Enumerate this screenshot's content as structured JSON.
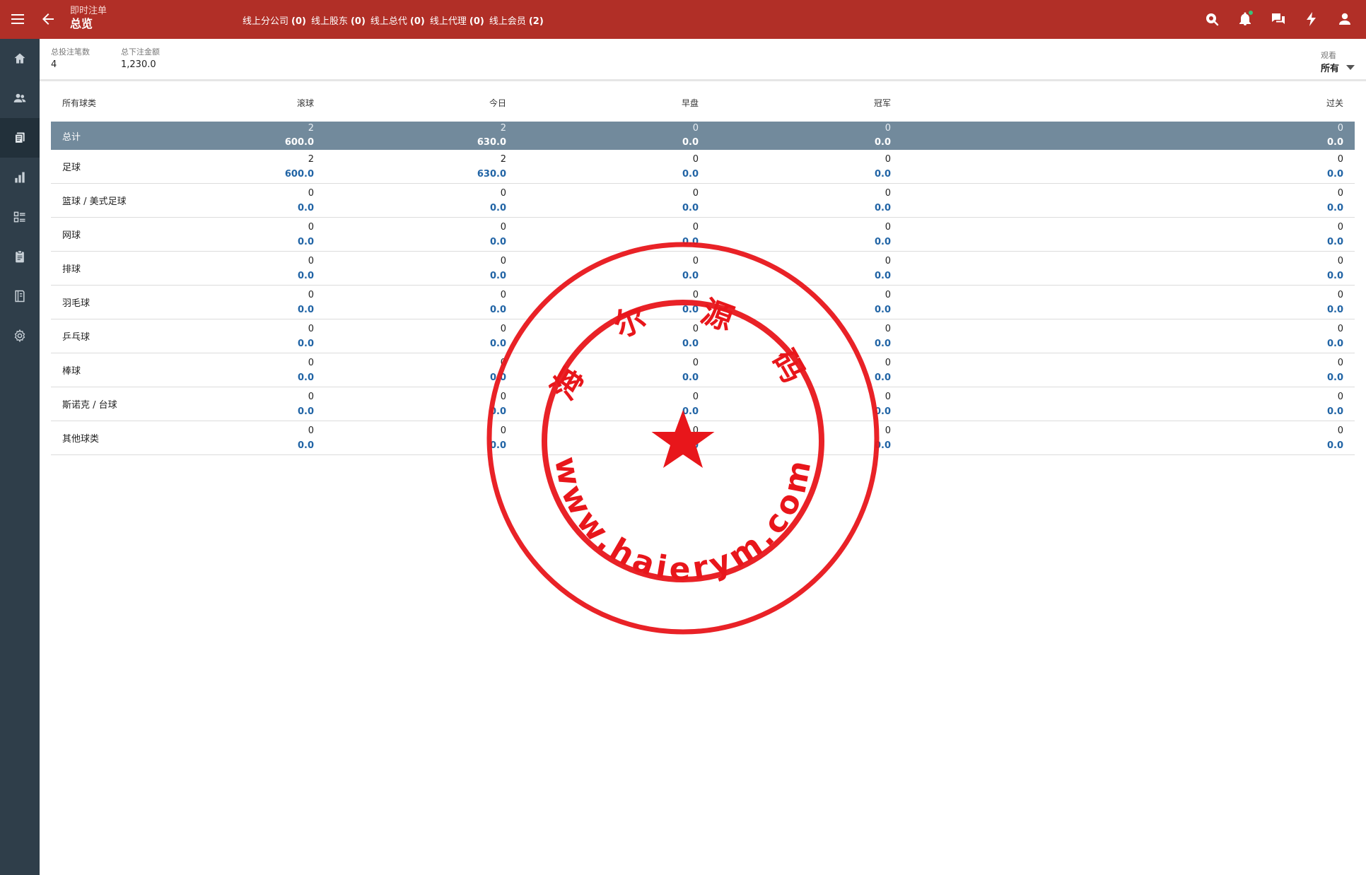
{
  "header": {
    "subtitle": "即时注单",
    "title": "总览",
    "nav": [
      {
        "label": "线上分公司",
        "count": "(0)"
      },
      {
        "label": "线上股东",
        "count": "(0)"
      },
      {
        "label": "线上总代",
        "count": "(0)"
      },
      {
        "label": "线上代理",
        "count": "(0)"
      },
      {
        "label": "线上会员",
        "count": "(2)"
      }
    ]
  },
  "summary": {
    "total_bets_label": "总投注笔数",
    "total_bets_value": "4",
    "total_amount_label": "总下注金额",
    "total_amount_value": "1,230.0",
    "view_label": "观看",
    "view_value": "所有"
  },
  "table": {
    "columns": [
      "所有球类",
      "滚球",
      "今日",
      "早盘",
      "冠军",
      "过关"
    ],
    "total": {
      "name": "总计",
      "cells": [
        [
          "2",
          "600.0"
        ],
        [
          "2",
          "630.0"
        ],
        [
          "0",
          "0.0"
        ],
        [
          "0",
          "0.0"
        ],
        [
          "0",
          "0.0"
        ]
      ]
    },
    "rows": [
      {
        "name": "足球",
        "cells": [
          [
            "2",
            "600.0"
          ],
          [
            "2",
            "630.0"
          ],
          [
            "0",
            "0.0"
          ],
          [
            "0",
            "0.0"
          ],
          [
            "0",
            "0.0"
          ]
        ]
      },
      {
        "name": "篮球 / 美式足球",
        "cells": [
          [
            "0",
            "0.0"
          ],
          [
            "0",
            "0.0"
          ],
          [
            "0",
            "0.0"
          ],
          [
            "0",
            "0.0"
          ],
          [
            "0",
            "0.0"
          ]
        ]
      },
      {
        "name": "网球",
        "cells": [
          [
            "0",
            "0.0"
          ],
          [
            "0",
            "0.0"
          ],
          [
            "0",
            "0.0"
          ],
          [
            "0",
            "0.0"
          ],
          [
            "0",
            "0.0"
          ]
        ]
      },
      {
        "name": "排球",
        "cells": [
          [
            "0",
            "0.0"
          ],
          [
            "0",
            "0.0"
          ],
          [
            "0",
            "0.0"
          ],
          [
            "0",
            "0.0"
          ],
          [
            "0",
            "0.0"
          ]
        ]
      },
      {
        "name": "羽毛球",
        "cells": [
          [
            "0",
            "0.0"
          ],
          [
            "0",
            "0.0"
          ],
          [
            "0",
            "0.0"
          ],
          [
            "0",
            "0.0"
          ],
          [
            "0",
            "0.0"
          ]
        ]
      },
      {
        "name": "乒乓球",
        "cells": [
          [
            "0",
            "0.0"
          ],
          [
            "0",
            "0.0"
          ],
          [
            "0",
            "0.0"
          ],
          [
            "0",
            "0.0"
          ],
          [
            "0",
            "0.0"
          ]
        ]
      },
      {
        "name": "棒球",
        "cells": [
          [
            "0",
            "0.0"
          ],
          [
            "0",
            "0.0"
          ],
          [
            "0",
            "0.0"
          ],
          [
            "0",
            "0.0"
          ],
          [
            "0",
            "0.0"
          ]
        ]
      },
      {
        "name": "斯诺克 / 台球",
        "cells": [
          [
            "0",
            "0.0"
          ],
          [
            "0",
            "0.0"
          ],
          [
            "0",
            "0.0"
          ],
          [
            "0",
            "0.0"
          ],
          [
            "0",
            "0.0"
          ]
        ]
      },
      {
        "name": "其他球类",
        "cells": [
          [
            "0",
            "0.0"
          ],
          [
            "0",
            "0.0"
          ],
          [
            "0",
            "0.0"
          ],
          [
            "0",
            "0.0"
          ],
          [
            "0",
            "0.0"
          ]
        ]
      }
    ]
  },
  "watermark": {
    "top_text": "海 尔 源 码",
    "bottom_text": "www.haierym.com",
    "color": "#e8161b"
  },
  "colors": {
    "topbar": "#b12f27",
    "sidebar": "#2f3e4a",
    "total_row": "#728a9c",
    "amount_blue": "#2164a5"
  }
}
